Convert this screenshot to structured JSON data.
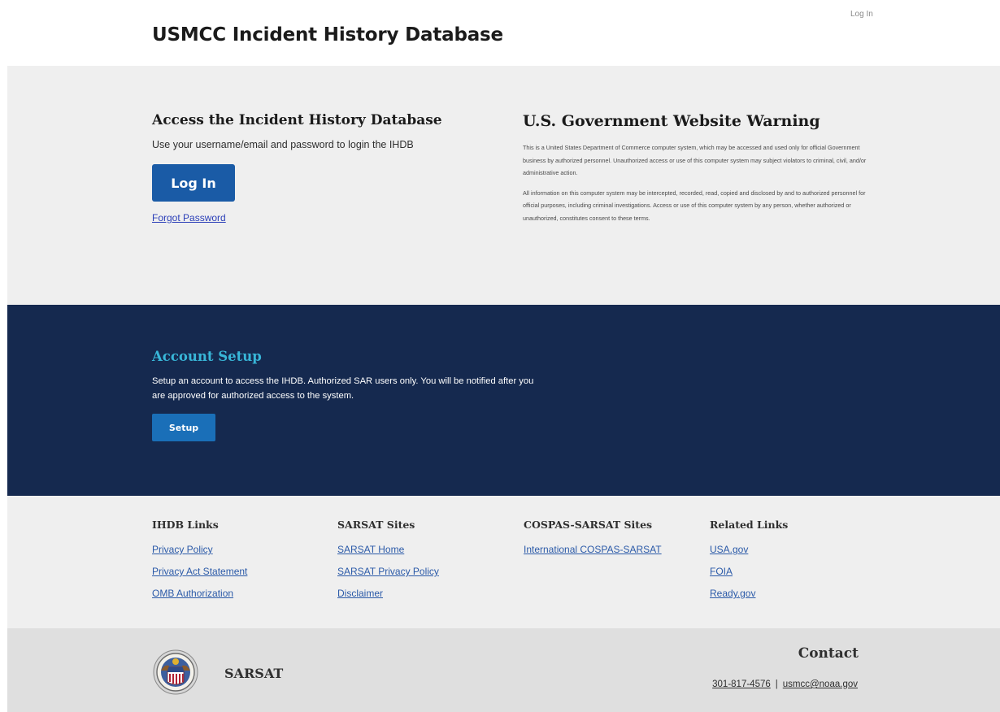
{
  "header": {
    "title": "USMCC Incident History Database",
    "login_link": "Log In"
  },
  "access": {
    "heading": "Access the Incident History Database",
    "description": "Use your username/email and password to login the IHDB",
    "login_button": "Log In",
    "forgot_link": "Forgot Password"
  },
  "warning": {
    "heading": "U.S. Government Website Warning",
    "paragraph1": "This is a United States Department of Commerce computer system, which may be accessed and used only for official Government business by authorized personnel. Unauthorized access or use of this computer system may subject violators to criminal, civil, and/or administrative action.",
    "paragraph2": "All information on this computer system may be intercepted, recorded, read, copied and disclosed by and to authorized personnel for official purposes, including criminal investigations. Access or use of this computer system by any person, whether authorized or unauthorized, constitutes consent to these terms."
  },
  "setup": {
    "heading": "Account Setup",
    "description": "Setup an account to access the IHDB. Authorized SAR users only. You will be notified after you are approved for authorized access to the system.",
    "button": "Setup"
  },
  "links": {
    "ihdb": {
      "heading": "IHDB Links",
      "items": [
        "Privacy Policy",
        "Privacy Act Statement",
        "OMB Authorization"
      ]
    },
    "sarsat": {
      "heading": "SARSAT Sites",
      "items": [
        "SARSAT Home",
        "SARSAT Privacy Policy",
        "Disclaimer"
      ]
    },
    "cospas": {
      "heading": "COSPAS-SARSAT Sites",
      "items": [
        "International COSPAS-SARSAT"
      ]
    },
    "related": {
      "heading": "Related Links",
      "items": [
        "USA.gov",
        "FOIA",
        "Ready.gov"
      ]
    }
  },
  "footer": {
    "org_name": "SARSAT",
    "seal_icon": "sarsat-seal-icon",
    "contact_heading": "Contact",
    "phone": "301-817-4576",
    "separator": "|",
    "email": "usmcc@noaa.gov"
  },
  "colors": {
    "primary_button": "#1a5ba6",
    "setup_band": "#15294f",
    "setup_heading": "#38b6d8",
    "link": "#2b5aa8"
  }
}
